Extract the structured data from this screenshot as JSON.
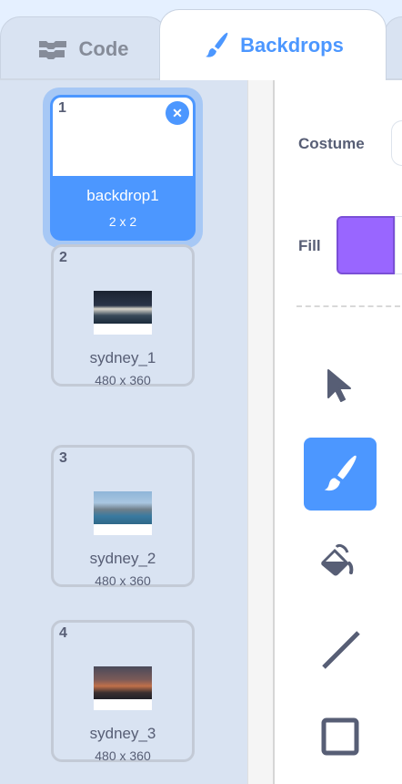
{
  "tabs": [
    {
      "label": "Code",
      "icon": "code-blocks-icon"
    },
    {
      "label": "Backdrops",
      "icon": "paintbrush-icon",
      "active": true
    }
  ],
  "backdrops": [
    {
      "index": "1",
      "name": "backdrop1",
      "size": "2 x 2",
      "selected": true
    },
    {
      "index": "2",
      "name": "sydney_1",
      "size": "480 x 360"
    },
    {
      "index": "3",
      "name": "sydney_2",
      "size": "480 x 360"
    },
    {
      "index": "4",
      "name": "sydney_3",
      "size": "480 x 360"
    }
  ],
  "editor": {
    "costume_label": "Costume",
    "fill_label": "Fill",
    "fill_color": "#9966ff",
    "active_tool": "brush"
  },
  "colors": {
    "accent": "#4c97ff",
    "text": "#575e75"
  }
}
